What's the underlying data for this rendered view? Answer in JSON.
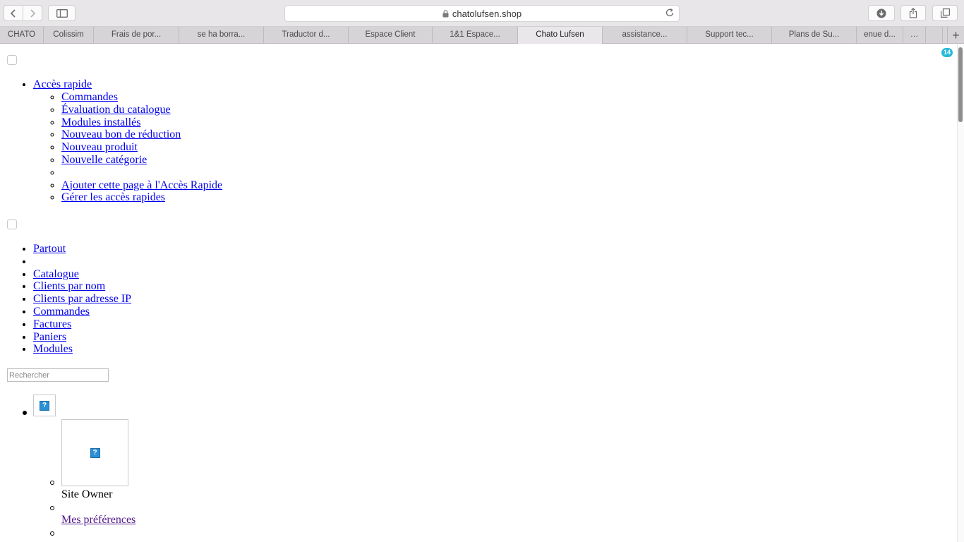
{
  "browser": {
    "url": "chatolufsen.shop",
    "tabs": [
      {
        "label": "CHATO",
        "active": false
      },
      {
        "label": "Colissim",
        "active": false
      },
      {
        "label": "Frais de por...",
        "active": false
      },
      {
        "label": "se ha borra...",
        "active": false
      },
      {
        "label": "Traductor d...",
        "active": false
      },
      {
        "label": "Espace Client",
        "active": false
      },
      {
        "label": "1&1 Espace...",
        "active": false
      },
      {
        "label": "Chato Lufsen",
        "active": true
      },
      {
        "label": "assistance...",
        "active": false
      },
      {
        "label": "Support tec...",
        "active": false
      },
      {
        "label": "Plans de Su...",
        "active": false
      },
      {
        "label": "enue d...",
        "active": false
      },
      {
        "label": "…",
        "active": false
      }
    ],
    "new_tab_label": "+"
  },
  "quick_access": {
    "title": "Accès rapide",
    "items": [
      "Commandes",
      "Évaluation du catalogue",
      "Modules installés",
      "Nouveau bon de réduction",
      "Nouveau produit",
      "Nouvelle catégorie",
      "",
      "Ajouter cette page à l'Accès Rapide",
      "Gérer les accès rapides"
    ]
  },
  "search_scope": {
    "items": [
      "Partout",
      "",
      "Catalogue",
      "Clients par nom",
      "Clients par adresse IP",
      "Commandes",
      "Factures",
      "Paniers",
      "Modules"
    ]
  },
  "search": {
    "placeholder": "Rechercher"
  },
  "profile": {
    "image_icon": "?",
    "name": "Site Owner",
    "preferences_label": " Mes préférences"
  },
  "notifications": {
    "count": "14",
    "color": "#25b9d7"
  },
  "colors": {
    "link": "#0000ee",
    "visited_link": "#551a8b"
  }
}
